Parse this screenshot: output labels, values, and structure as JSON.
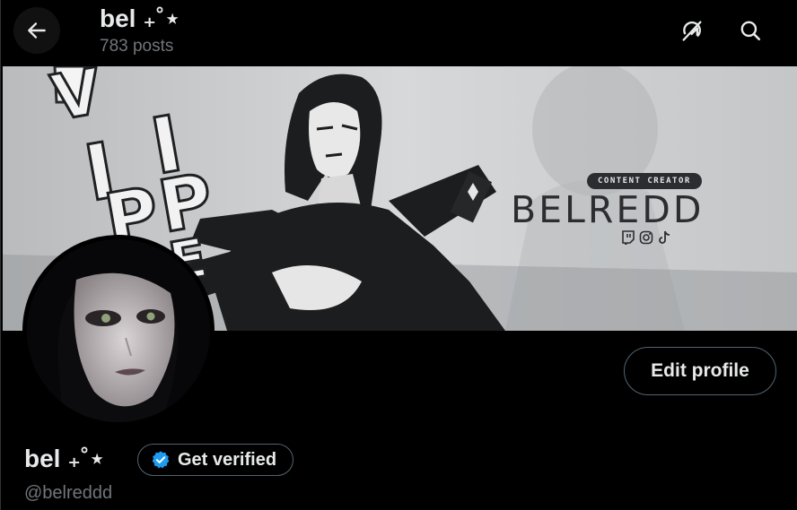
{
  "header": {
    "title": "bel ₊˚⋆",
    "posts_count": "783 posts"
  },
  "banner": {
    "subtitle": "CONTENT CREATOR",
    "brand": "BELREDD",
    "side_letters": [
      "V",
      "I",
      "P",
      "P",
      "E"
    ],
    "socials": [
      "twitch-icon",
      "instagram-icon",
      "tiktok-icon"
    ]
  },
  "profile": {
    "display_name": "bel ₊˚⋆",
    "handle": "@belreddd",
    "edit_label": "Edit profile",
    "verify_label": "Get verified"
  },
  "colors": {
    "background": "#000000",
    "text": "#e7e9ea",
    "muted": "#71767b",
    "border": "#536471",
    "verify_blue": "#1d9bf0"
  }
}
